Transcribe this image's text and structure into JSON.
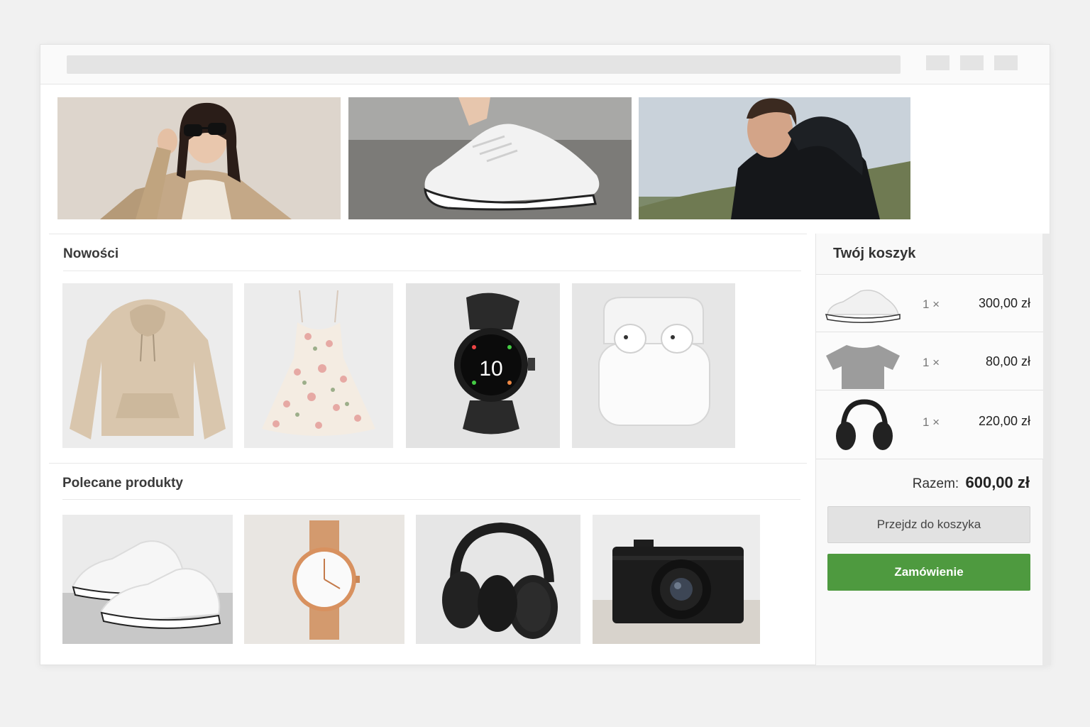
{
  "browser": {
    "address_value": "",
    "window_buttons": [
      "minimize",
      "maximize",
      "close"
    ]
  },
  "hero_banners": [
    {
      "name": "hero-woman-sunglasses",
      "icon": "woman-sunglasses-image"
    },
    {
      "name": "hero-sneaker",
      "icon": "sneaker-image"
    },
    {
      "name": "hero-man-jacket",
      "icon": "man-jacket-image"
    }
  ],
  "sections": {
    "new_title": "Nowości",
    "new_products": [
      {
        "icon": "hoodie-image"
      },
      {
        "icon": "dress-image"
      },
      {
        "icon": "smartwatch-image",
        "screen_time": "10"
      },
      {
        "icon": "earbuds-image"
      }
    ],
    "recommended_title": "Polecane produkty",
    "recommended_products": [
      {
        "icon": "sneakers-image"
      },
      {
        "icon": "wristwatch-image"
      },
      {
        "icon": "headphones-image"
      },
      {
        "icon": "camera-image"
      }
    ]
  },
  "cart": {
    "title": "Twój koszyk",
    "items": [
      {
        "icon": "sneaker-thumb",
        "qty": "1 ×",
        "price": "300,00 zł"
      },
      {
        "icon": "tshirt-thumb",
        "qty": "1 ×",
        "price": "80,00 zł"
      },
      {
        "icon": "headphones-thumb",
        "qty": "1 ×",
        "price": "220,00 zł"
      }
    ],
    "total_label": "Razem:",
    "total_value": "600,00 zł",
    "go_to_cart_label": "Przejdz do koszyka",
    "order_label": "Zamówienie"
  },
  "colors": {
    "accent_green": "#4e9a3f",
    "button_gray": "#e2e2e2"
  }
}
